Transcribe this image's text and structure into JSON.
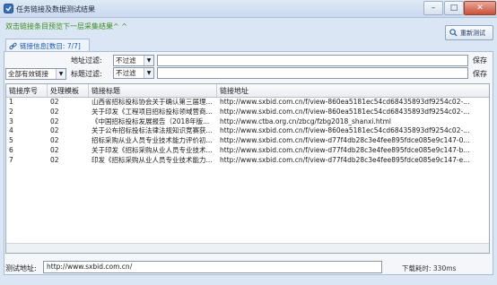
{
  "window": {
    "title": "任务链接及数据测试结果"
  },
  "hint": "双击链接条目预览下一层采集结果^ ^",
  "reset_button": "重新测试",
  "tab": "链接信息[数目: 7/7]",
  "filters": {
    "url_filter_label": "地址过滤:",
    "url_filter_value": "不过滤",
    "title_filter_label": "标题过滤:",
    "title_filter_value": "不过滤",
    "link_select": "全部有效链接",
    "save": "保存"
  },
  "table": {
    "columns": [
      "链接序号",
      "处理模板",
      "链接标题",
      "链接地址"
    ],
    "rows": [
      [
        "1",
        "02",
        "山西省招标投标协会关于确认第三届理...",
        "http://www.sxbid.com.cn/f/view-860ea5181ec54cd68435893df9254c02-..."
      ],
      [
        "2",
        "02",
        "关于印发《工程项目招标投标领域营商环...",
        "http://www.sxbid.com.cn/f/view-860ea5181ec54cd68435893df9254c02-..."
      ],
      [
        "3",
        "02",
        "《中国招标投标发展报告（2018年版...",
        "http://www.ctba.org.cn/zbcg/fzbg2018_shanxi.html"
      ],
      [
        "4",
        "02",
        "关于公布招标投标法律法规知识竞赛获...",
        "http://www.sxbid.com.cn/f/view-860ea5181ec54cd68435893df9254c02-..."
      ],
      [
        "5",
        "02",
        "招标采购从业人员专业技术能力评价初...",
        "http://www.sxbid.com.cn/f/view-d77f4db28c3e4fee895fdce085e9c147-0..."
      ],
      [
        "6",
        "02",
        "关于印发《招标采购从业人员专业技术...",
        "http://www.sxbid.com.cn/f/view-d77f4db28c3e4fee895fdce085e9c147-b..."
      ],
      [
        "7",
        "02",
        "印发《招标采购从业人员专业技术能力...",
        "http://www.sxbid.com.cn/f/view-d77f4db28c3e4fee895fdce085e9c147-e..."
      ]
    ]
  },
  "bottom": {
    "test_address_label": "测试地址:",
    "test_address_value": "http://www.sxbid.com.cn/",
    "status": "下载耗时: 330ms"
  }
}
